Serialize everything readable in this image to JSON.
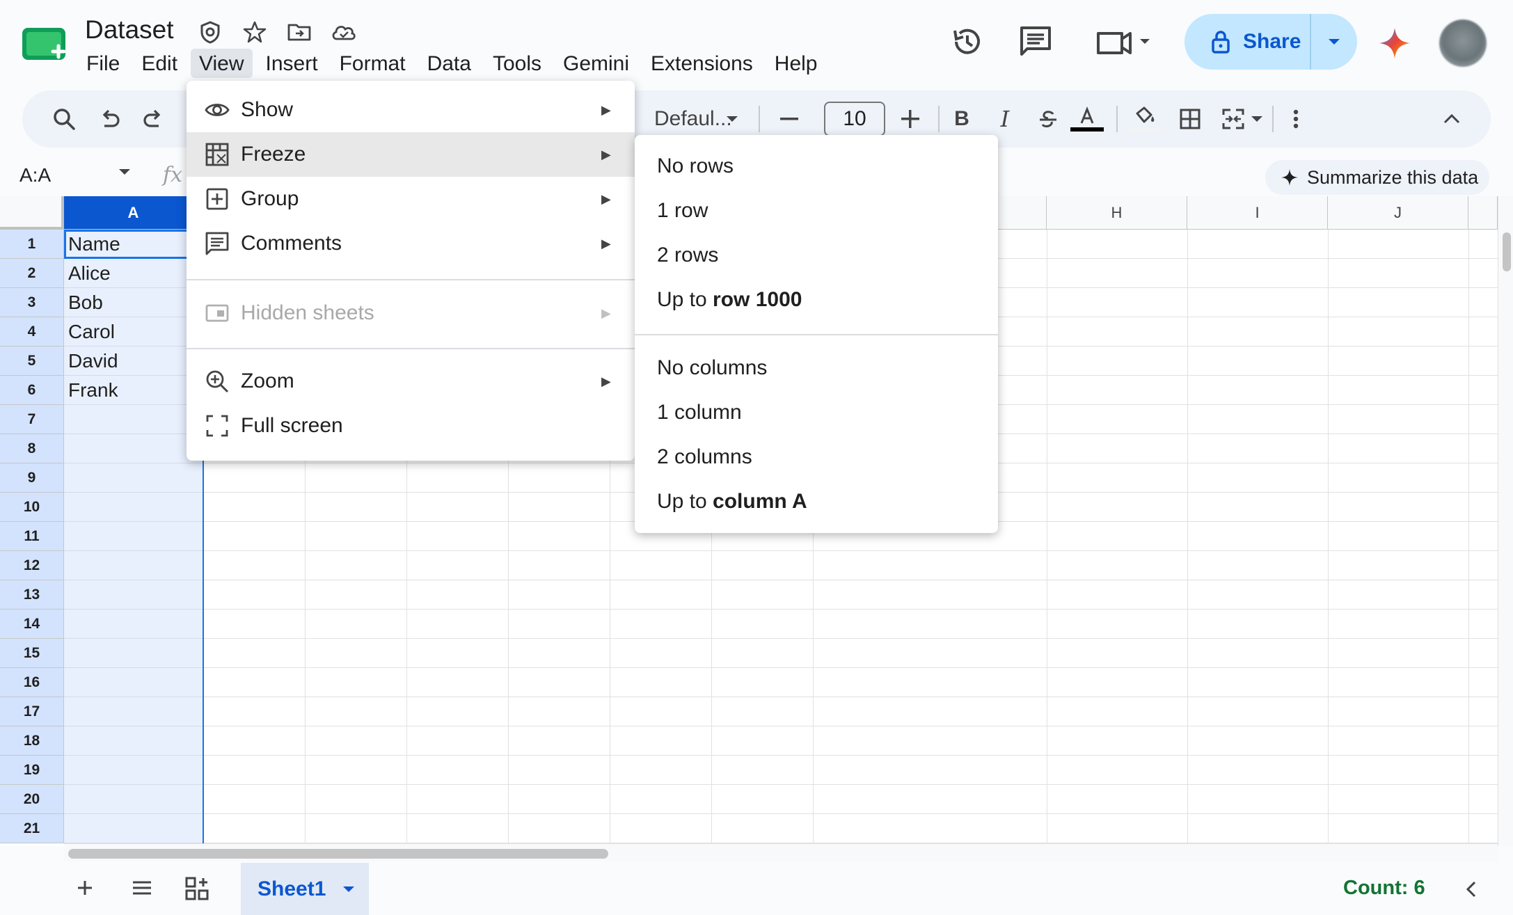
{
  "header": {
    "title": "Dataset",
    "menus": [
      "File",
      "Edit",
      "View",
      "Insert",
      "Format",
      "Data",
      "Tools",
      "Gemini",
      "Extensions",
      "Help"
    ],
    "active_menu": "View",
    "share_label": "Share"
  },
  "toolbar": {
    "font_name": "Defaul...",
    "font_size": "10"
  },
  "formula_bar": {
    "name_box": "A:A",
    "fx": "fx",
    "summarize_label": "Summarize this data"
  },
  "grid": {
    "columns": [
      "A",
      "H",
      "I",
      "J"
    ],
    "selected_column": "A",
    "rows": [
      "1",
      "2",
      "3",
      "4",
      "5",
      "6",
      "7",
      "8",
      "9",
      "10",
      "11",
      "12",
      "13",
      "14",
      "15",
      "16",
      "17",
      "18",
      "19",
      "20",
      "21"
    ],
    "column_a_values": [
      "Name",
      "Alice",
      "Bob",
      "Carol",
      "David",
      "Frank"
    ]
  },
  "view_menu": {
    "items": [
      {
        "label": "Show",
        "icon": "eye-icon",
        "submenu": true
      },
      {
        "label": "Freeze",
        "icon": "freeze-grid-icon",
        "submenu": true,
        "highlighted": true
      },
      {
        "label": "Group",
        "icon": "group-plus-icon",
        "submenu": true
      },
      {
        "label": "Comments",
        "icon": "comment-icon",
        "submenu": true
      },
      {
        "label": "Hidden sheets",
        "icon": "hidden-sheet-icon",
        "submenu": true,
        "disabled": true
      },
      {
        "label": "Zoom",
        "icon": "zoom-in-icon",
        "submenu": true
      },
      {
        "label": "Full screen",
        "icon": "fullscreen-icon",
        "submenu": false
      }
    ]
  },
  "freeze_menu": {
    "no_rows": "No rows",
    "one_row": "1 row",
    "two_rows": "2 rows",
    "up_to_row_prefix": "Up to ",
    "up_to_row_bold": "row 1000",
    "no_columns": "No columns",
    "one_column": "1 column",
    "two_columns": "2 columns",
    "up_to_column_prefix": "Up to ",
    "up_to_column_bold": "column A"
  },
  "bottom_bar": {
    "sheet_tab": "Sheet1",
    "count": "Count: 6"
  },
  "colors": {
    "accent_blue": "#0b57d0",
    "share_bg": "#c2e7ff",
    "selected_col_bg": "#e8f0fe",
    "count_green": "#137333"
  }
}
